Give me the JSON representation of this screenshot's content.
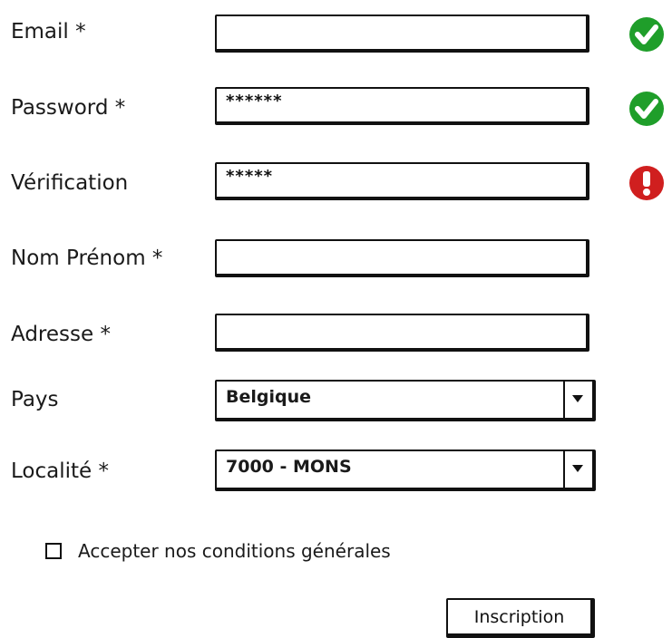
{
  "fields": [
    {
      "id": "email",
      "label": "Email *",
      "value": "",
      "status": "valid"
    },
    {
      "id": "password",
      "label": "Password *",
      "value": "******",
      "status": "valid"
    },
    {
      "id": "verification",
      "label": "Vérification",
      "value": "*****",
      "status": "error"
    },
    {
      "id": "nom",
      "label": "Nom Prénom *",
      "value": ""
    },
    {
      "id": "adresse",
      "label": "Adresse *",
      "value": ""
    }
  ],
  "pays": {
    "label": "Pays",
    "selected": "Belgique"
  },
  "localite": {
    "label": "Localité *",
    "selected": "7000 - MONS"
  },
  "terms": {
    "label": "Accepter nos conditions générales",
    "checked": false
  },
  "submit_label": "Inscription",
  "colors": {
    "valid": "#1f9e2a",
    "error": "#d01f1f",
    "ink": "#111111"
  },
  "icons": {
    "valid": "check-circle-icon",
    "error": "exclamation-circle-icon",
    "dropdown": "caret-down-icon"
  }
}
